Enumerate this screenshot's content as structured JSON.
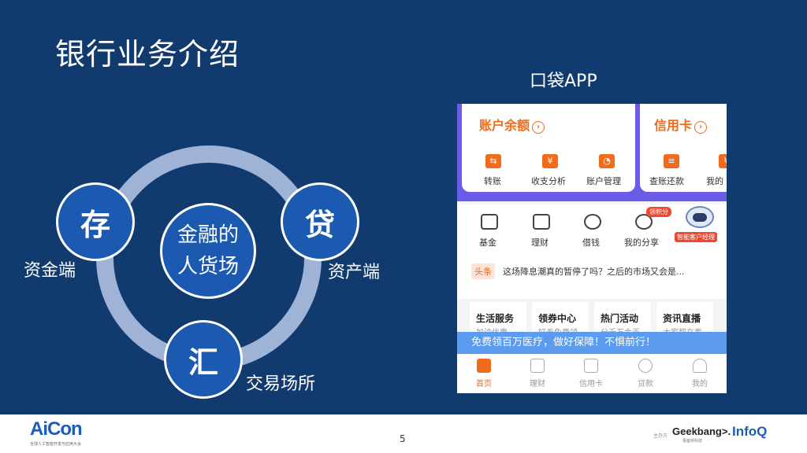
{
  "slide": {
    "title": "银行业务介绍",
    "app_title": "口袋APP"
  },
  "diagram": {
    "center_line1": "金融的",
    "center_line2": "人货场",
    "node_deposit": "存",
    "node_loan": "贷",
    "node_exchange": "汇",
    "label_funds": "资金端",
    "label_assets": "资产端",
    "label_trading": "交易场所"
  },
  "phone": {
    "account_balance": "账户余额",
    "credit_card": "信用卡",
    "quick_actions": [
      "转账",
      "收支分析",
      "账户管理",
      "查账还款",
      "我的"
    ],
    "quick_icons": [
      "⇆",
      "¥",
      "◔",
      "≡",
      "¥"
    ],
    "menu": [
      "基金",
      "理财",
      "借钱",
      "我的分享"
    ],
    "share_badge": "领积分",
    "assistant_badge": "智能客户经理",
    "news_tag": "头条",
    "news_text": "这场降息潮真的暂停了吗？之后的市场又会是...",
    "services": [
      {
        "title": "生活服务",
        "sub": "加油优惠"
      },
      {
        "title": "领券中心",
        "sub": "好券免费领"
      },
      {
        "title": "热门活动",
        "sub": "分千万金币"
      },
      {
        "title": "资讯直播",
        "sub": "大家都在看"
      }
    ],
    "banner": "免费领百万医疗，做好保障！不惧前行！",
    "tabs": [
      "首页",
      "理财",
      "信用卡",
      "贷款",
      "我的"
    ]
  },
  "footer": {
    "logo": "AiCon",
    "logo_sub": "全球人工智能开发与应用大会",
    "page": "5",
    "host_label": "主办方",
    "geekbang": "Geekbang>.",
    "geekbang_sub": "极客邦科技",
    "infoq": "InfoQ"
  },
  "colors": {
    "background": "#113a6e",
    "accent": "#f06a19",
    "node": "#1b5ab0",
    "ring": "#9fb3d7"
  }
}
